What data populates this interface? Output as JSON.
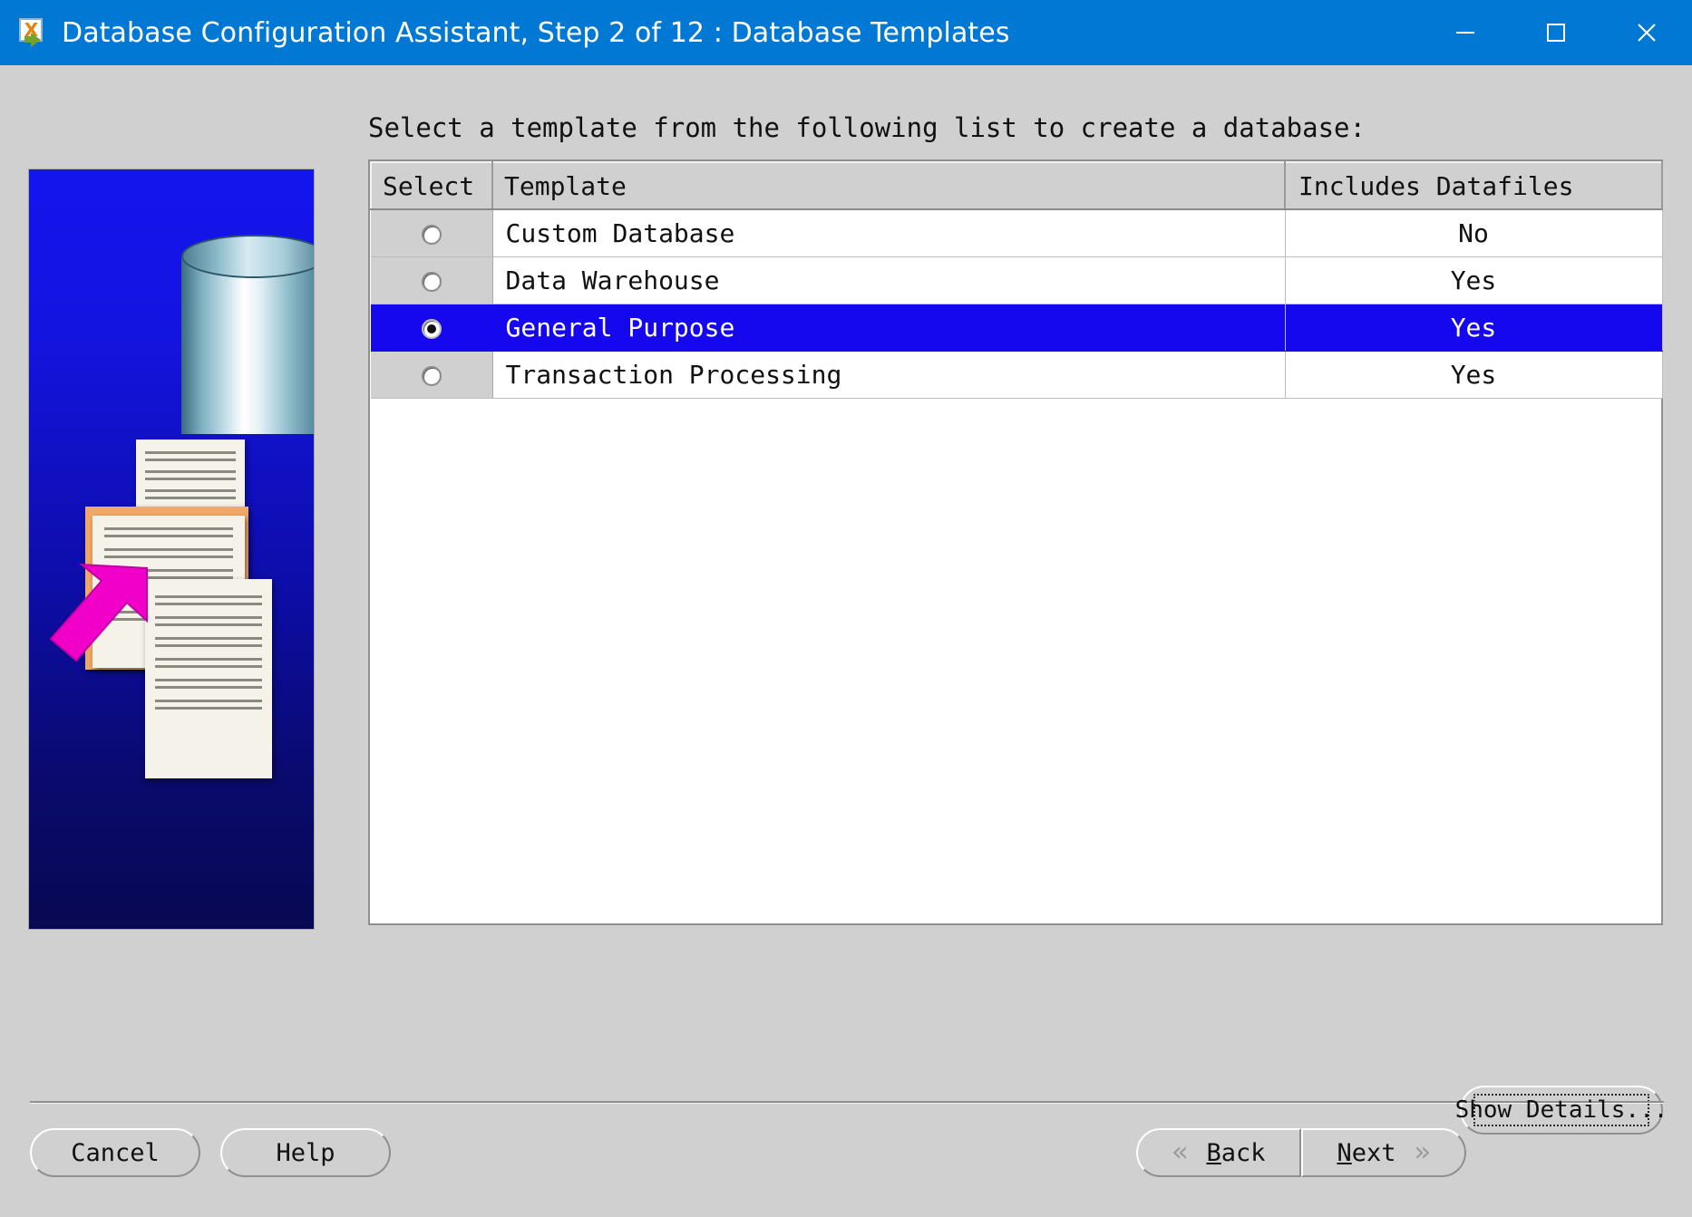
{
  "window": {
    "title": "Database Configuration Assistant, Step 2 of 12 : Database Templates",
    "icon": "oracle-dbca-icon",
    "titlebar_color": "#0078d4",
    "controls": {
      "minimize": "minimize-icon",
      "maximize": "maximize-icon",
      "close": "close-icon"
    }
  },
  "sidebar": {
    "image_alt": "database-cylinder-with-documents-graphic",
    "background_colors": [
      "#1414ee",
      "#080852"
    ],
    "arrow_color": "#ff00cc"
  },
  "main": {
    "instruction": "Select a template from the following list to create a database:",
    "table": {
      "columns": [
        "Select",
        "Template",
        "Includes Datafiles"
      ],
      "rows": [
        {
          "selected": false,
          "template": "Custom Database",
          "includes_datafiles": "No"
        },
        {
          "selected": false,
          "template": "Data Warehouse",
          "includes_datafiles": "Yes"
        },
        {
          "selected": true,
          "template": "General Purpose",
          "includes_datafiles": "Yes"
        },
        {
          "selected": false,
          "template": "Transaction Processing",
          "includes_datafiles": "Yes"
        }
      ],
      "selection_color": "#1507ee"
    },
    "show_details_label": "Show Details..."
  },
  "footer": {
    "cancel_label": "Cancel",
    "help_label": "Help",
    "back_label": "Back",
    "back_mnemonic": "B",
    "next_label": "Next",
    "next_mnemonic": "N",
    "back_chevron": "«",
    "next_chevron": "»"
  }
}
